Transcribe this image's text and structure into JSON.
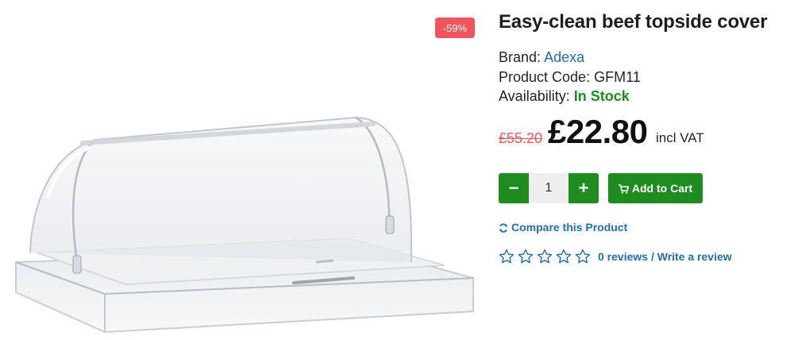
{
  "product": {
    "title": "Easy-clean beef topside cover",
    "discount_badge": "-59%",
    "image_description": "product-photo-clear-roll-top-display-cover",
    "brand_label": "Brand:",
    "brand_value": "Adexa",
    "code_label": "Product Code:",
    "code_value": "GFM11",
    "availability_label": "Availability:",
    "availability_value": "In Stock"
  },
  "price": {
    "old": "£55.20",
    "current": "£22.80",
    "vat_note": "incl VAT"
  },
  "cart": {
    "minus_label": "−",
    "quantity": "1",
    "plus_label": "+",
    "add_label": "Add to Cart"
  },
  "links": {
    "compare": "Compare this Product",
    "reviews": "0 reviews",
    "separator": " / ",
    "write_review": "Write a review"
  },
  "rating": {
    "value": 0,
    "max": 5
  },
  "colors": {
    "accent_green": "#1e8c1e",
    "link_blue": "#1f6fa8",
    "sale_red": "#f0545d"
  },
  "icons": [
    "cart-icon",
    "refresh-icon",
    "star-outline-icon"
  ]
}
